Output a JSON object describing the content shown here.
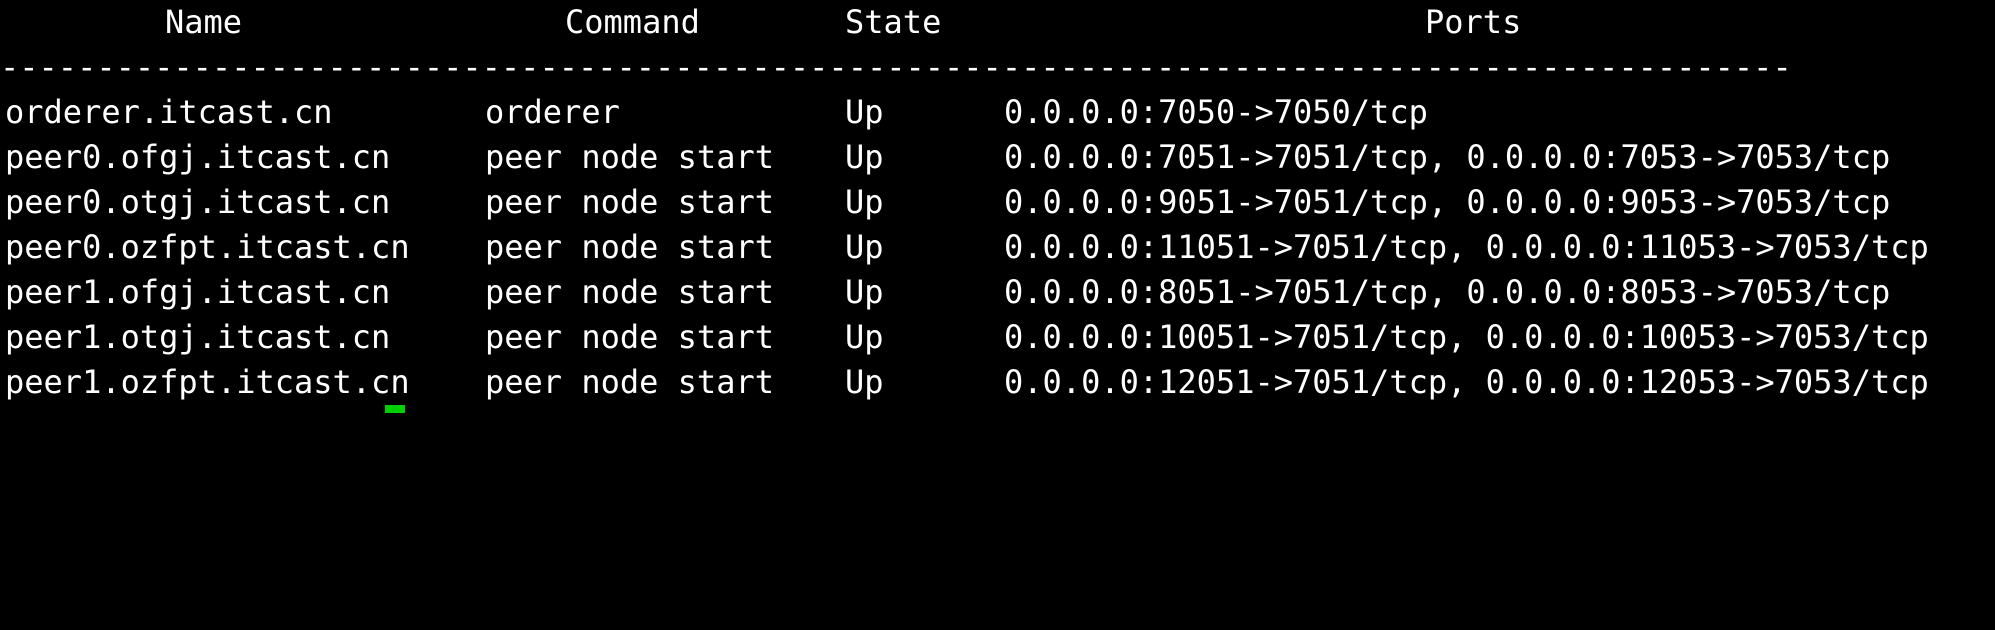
{
  "window": {
    "background": "#000000",
    "foreground": "#ffffff",
    "cursor_color": "#00d000"
  },
  "table": {
    "headers": {
      "name": "Name",
      "command": "Command",
      "state": "State",
      "ports": "Ports"
    },
    "separator": "---------------------------------------------------------------------------------------------",
    "rows": [
      {
        "name": "orderer.itcast.cn",
        "command": "orderer",
        "state": "Up",
        "ports": "0.0.0.0:7050->7050/tcp"
      },
      {
        "name": "peer0.ofgj.itcast.cn",
        "command": "peer node start",
        "state": "Up",
        "ports": "0.0.0.0:7051->7051/tcp, 0.0.0.0:7053->7053/tcp"
      },
      {
        "name": "peer0.otgj.itcast.cn",
        "command": "peer node start",
        "state": "Up",
        "ports": "0.0.0.0:9051->7051/tcp, 0.0.0.0:9053->7053/tcp"
      },
      {
        "name": "peer0.ozfpt.itcast.cn",
        "command": "peer node start",
        "state": "Up",
        "ports": "0.0.0.0:11051->7051/tcp, 0.0.0.0:11053->7053/tcp"
      },
      {
        "name": "peer1.ofgj.itcast.cn",
        "command": "peer node start",
        "state": "Up",
        "ports": "0.0.0.0:8051->7051/tcp, 0.0.0.0:8053->7053/tcp"
      },
      {
        "name": "peer1.otgj.itcast.cn",
        "command": "peer node start",
        "state": "Up",
        "ports": "0.0.0.0:10051->7051/tcp, 0.0.0.0:10053->7053/tcp"
      },
      {
        "name": "peer1.ozfpt.itcast.cn",
        "command": "peer node start",
        "state": "Up",
        "ports": "0.0.0.0:12051->7051/tcp, 0.0.0.0:12053->7053/tcp"
      }
    ]
  }
}
